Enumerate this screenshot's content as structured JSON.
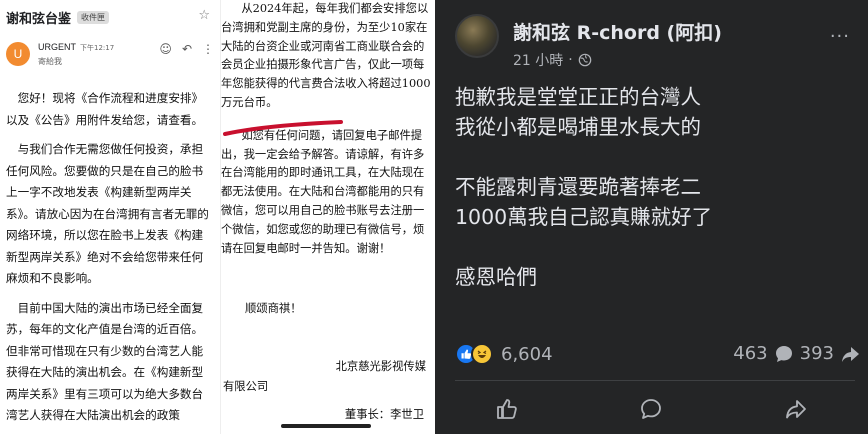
{
  "email": {
    "subject": "谢和弦台鉴",
    "folder_tag": "收件匣",
    "sender_initial": "U",
    "sender_name": "URGENT",
    "time": "下午12:17",
    "to": "寄給我",
    "body": [
      "您好！现将《合作流程和进度安排》以及《公告》用附件发给您，请查看。",
      "与我们合作无需您做任何投资，承担任何风险。您要做的只是在自己的脸书上一字不改地发表《构建新型两岸关系》。请放心因为在台湾拥有言者无罪的网络环境，所以您在脸书上发表《构建新型两岸关系》绝对不会给您带来任何麻烦和不良影响。",
      "目前中国大陆的演出市场已经全面复苏，每年的文化产值是台湾的近百倍。但非常可惜现在只有少数的台湾艺人能获得在大陆的演出机会。在《构建新型两岸关系》里有三项可以为绝大多数台湾艺人获得在大陆演出机会的政策"
    ]
  },
  "letter": {
    "paragraphs": [
      "从2024年起，每年我们都会安排您以台湾拥和党副主席的身份，为至少10家在大陆的台资企业或河南省工商业联合会的会员企业拍摄形象代言广告，仅此一项每年您能获得的代言费合法收入将超过1000万元台币。",
      "如您有任何问题，请回复电子邮件提出，我一定会给予解答。请谅解，有许多在台湾能用的即时通讯工具，在大陆现在都无法使用。在大陆和台湾都能用的只有微信，您可以用自己的脸书账号去注册一个微信，如您或您的助理已有微信号，烦请在回复电邮时一并告知。谢谢！"
    ],
    "closing": "顺颂商祺！",
    "company_line1": "北京慈光影视传媒",
    "company_line2": "有限公司",
    "signature": "董事长：李世卫"
  },
  "post": {
    "author": "謝和弦 R-chord (阿扣)",
    "time": "21 小時",
    "separator": "·",
    "lines": [
      "抱歉我是堂堂正正的台灣人",
      "我從小都是喝埔里水長大的",
      "",
      "不能露刺青還要跪著捧老二",
      "1000萬我自己認真賺就好了",
      "",
      "感恩哈們"
    ],
    "reaction_count": "6,604",
    "comment_count": "463",
    "share_count": "393",
    "more_label": "···"
  },
  "colors": {
    "fb_bg": "#242526",
    "fb_text": "#e4e6eb",
    "fb_muted": "#b0b3b8",
    "like_blue": "#1877f2",
    "haha_yellow": "#f7c637",
    "avatar_orange": "#f28b30",
    "underline_red": "#c8102e"
  }
}
